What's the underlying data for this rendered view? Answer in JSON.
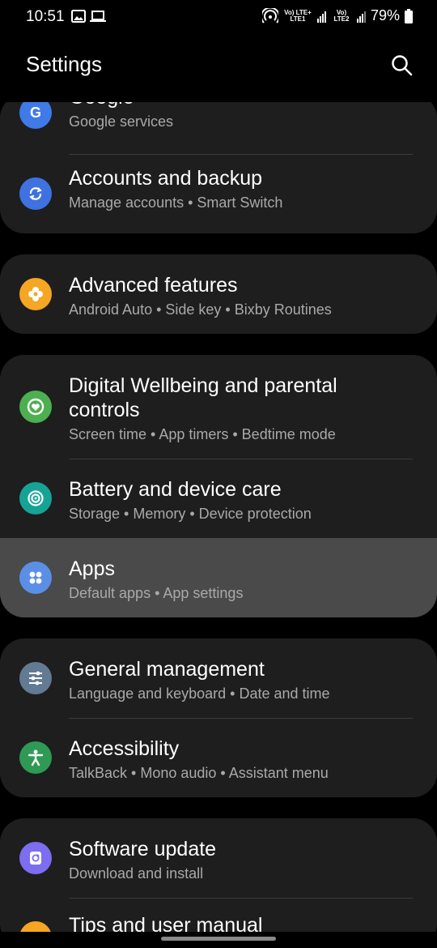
{
  "status_bar": {
    "time": "10:51",
    "sim1_label": "Vo) LTE+ LTE1",
    "sim2_label": "Vo) LTE2",
    "battery": "79%"
  },
  "header": {
    "title": "Settings"
  },
  "items": [
    {
      "label": "Google",
      "sub": "Google services",
      "icon": "google-icon",
      "color": "#3f7ae8"
    },
    {
      "label": "Accounts and backup",
      "sub": "Manage accounts  •  Smart Switch",
      "icon": "sync-icon",
      "color": "#3f72e0"
    },
    {
      "label": "Advanced features",
      "sub": "Android Auto  •  Side key  •  Bixby Routines",
      "icon": "flower-icon",
      "color": "#f5a623"
    },
    {
      "label": "Digital Wellbeing and parental",
      "label2": "controls",
      "sub": "Screen time  •  App timers  •  Bedtime mode",
      "icon": "wellbeing-icon",
      "color": "#4caf50"
    },
    {
      "label": "Battery and device care",
      "sub": "Storage  •  Memory  •  Device protection",
      "icon": "device-care-icon",
      "color": "#16a396"
    },
    {
      "label": "Apps",
      "sub": "Default apps  •  App settings",
      "icon": "apps-grid-icon",
      "color": "#5b8fe6"
    },
    {
      "label": "General management",
      "sub": "Language and keyboard  •  Date and time",
      "icon": "sliders-icon",
      "color": "#637a93"
    },
    {
      "label": "Accessibility",
      "sub": "TalkBack  •  Mono audio  •  Assistant menu",
      "icon": "accessibility-icon",
      "color": "#2f9a55"
    },
    {
      "label": "Software update",
      "sub": "Download and install",
      "icon": "software-update-icon",
      "color": "#7d6df0"
    },
    {
      "label": "Tips and user manual",
      "icon": "tips-icon",
      "color": "#f5a623"
    }
  ]
}
